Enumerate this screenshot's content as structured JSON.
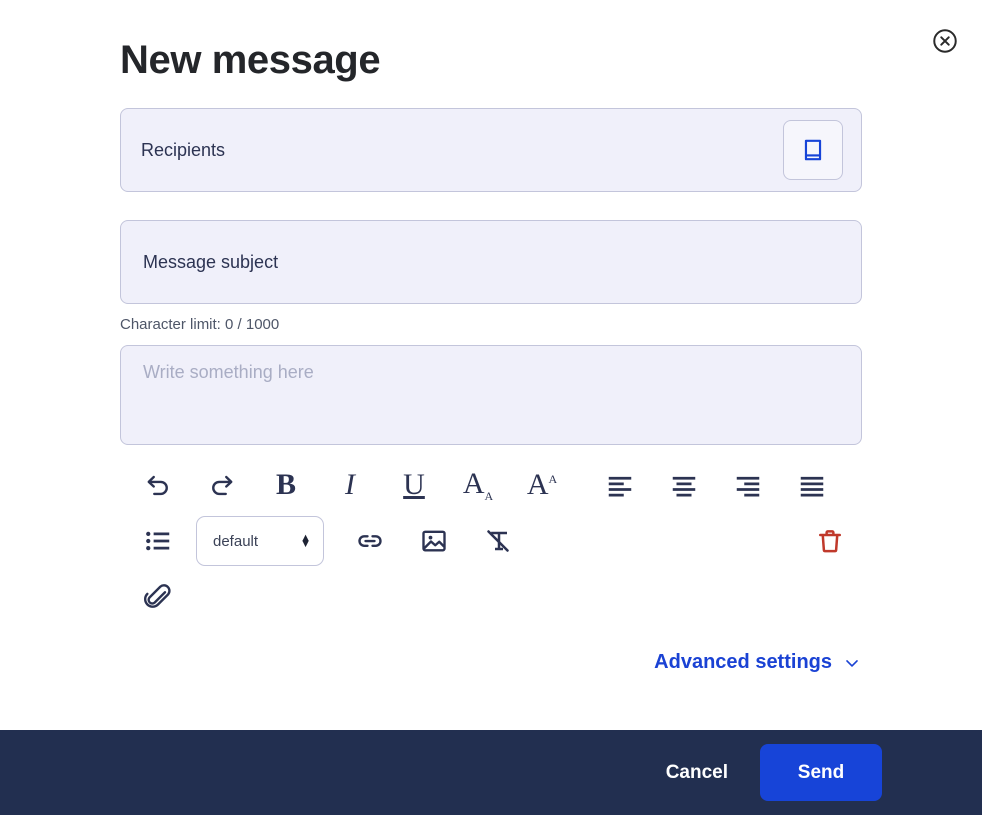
{
  "dialog": {
    "title": "New message",
    "close_icon": "close-circle-icon"
  },
  "recipients": {
    "placeholder": "Recipients",
    "value": "",
    "addressbook_icon": "address-book-icon"
  },
  "subject": {
    "placeholder": "Message subject",
    "value": "",
    "char_limit_text": "Character limit: 0 / 1000",
    "char_count": 0,
    "char_max": 1000
  },
  "body": {
    "placeholder": "Write something here",
    "value": ""
  },
  "toolbar": {
    "row1": [
      {
        "name": "undo-button",
        "icon": "undo-icon",
        "label": "Undo"
      },
      {
        "name": "redo-button",
        "icon": "redo-icon",
        "label": "Redo"
      },
      {
        "name": "bold-button",
        "icon": "bold-icon",
        "label": "B"
      },
      {
        "name": "italic-button",
        "icon": "italic-icon",
        "label": "I"
      },
      {
        "name": "underline-button",
        "icon": "underline-icon",
        "label": "U"
      },
      {
        "name": "decrease-font-size-button",
        "icon": "font-decrease-icon",
        "label": "A"
      },
      {
        "name": "increase-font-size-button",
        "icon": "font-increase-icon",
        "label": "A"
      },
      {
        "name": "align-left-button",
        "icon": "align-left-icon",
        "label": "Align left"
      },
      {
        "name": "align-center-button",
        "icon": "align-center-icon",
        "label": "Align center"
      },
      {
        "name": "align-right-button",
        "icon": "align-right-icon",
        "label": "Align right"
      },
      {
        "name": "align-justify-button",
        "icon": "align-justify-icon",
        "label": "Justify"
      }
    ],
    "row2": [
      {
        "name": "bullet-list-button",
        "icon": "bullet-list-icon",
        "label": "Bullet list"
      },
      {
        "name": "insert-link-button",
        "icon": "link-icon",
        "label": "Insert link"
      },
      {
        "name": "insert-image-button",
        "icon": "image-icon",
        "label": "Insert image"
      },
      {
        "name": "clear-formatting-button",
        "icon": "clear-formatting-icon",
        "label": "Clear formatting"
      },
      {
        "name": "delete-button",
        "icon": "trash-icon",
        "label": "Delete"
      }
    ],
    "row3": [
      {
        "name": "attach-file-button",
        "icon": "paperclip-icon",
        "label": "Attach file"
      }
    ],
    "font_select": {
      "value": "default",
      "options": [
        "default"
      ]
    }
  },
  "advanced": {
    "label": "Advanced settings",
    "chevron_icon": "chevron-down-icon"
  },
  "footer": {
    "cancel_label": "Cancel",
    "send_label": "Send"
  },
  "colors": {
    "accent_blue": "#1744d8",
    "footer_navy": "#222f50",
    "icon_navy": "#2c3352",
    "field_bg": "#f0f0fa",
    "field_border": "#c3c5db",
    "danger_red": "#c0392b",
    "title_black": "#24262a"
  }
}
